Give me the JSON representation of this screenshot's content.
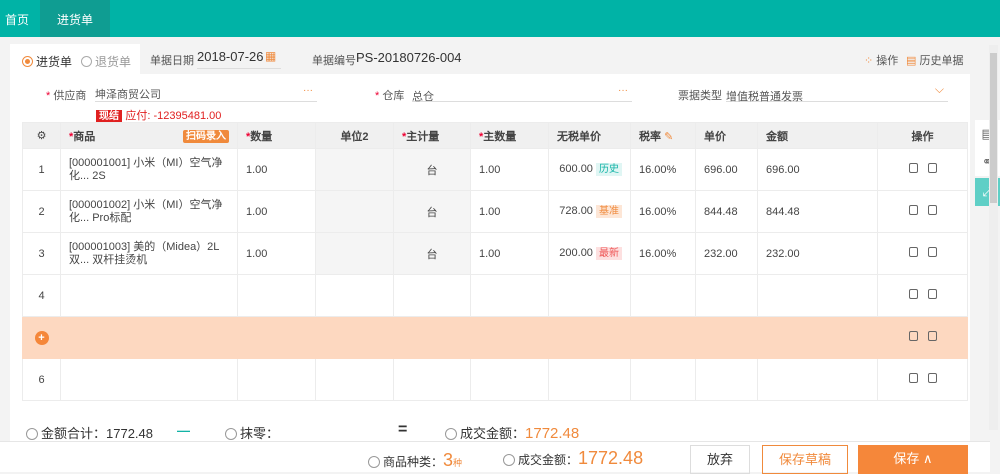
{
  "nav": {
    "home": "首页",
    "active_tab": "进货单"
  },
  "header": {
    "type_purchase": "进货单",
    "type_return": "退货单",
    "date_label": "单据日期",
    "date": "2018-07-26",
    "number_label": "单据编号",
    "number": "PS-20180726-004",
    "ops": "操作",
    "history": "历史单据"
  },
  "form": {
    "supplier_label": "供应商",
    "supplier": "坤泽商贸公司",
    "warehouse_label": "仓库",
    "warehouse": "总仓",
    "invoice_label": "票据类型",
    "invoice": "增值税普通发票",
    "cash_badge": "现结",
    "payable": "应付: -12395481.00",
    "dots": "···",
    "required": "*"
  },
  "table": {
    "scan_btn": "扫码录入",
    "headers": [
      "",
      "商品",
      "数量",
      "单位2",
      "主计量",
      "主数量",
      "无税单价",
      "税率",
      "单价",
      "金额",
      "操作"
    ],
    "rows": [
      {
        "no": "1",
        "product": "[000001001] 小米（MI）空气净化... 2S",
        "qty": "1.00",
        "unit": "台",
        "main_qty": "1.00",
        "price_ex": "600.00",
        "tag": "历史",
        "tax": "16.00%",
        "price": "696.00",
        "amount": "696.00"
      },
      {
        "no": "2",
        "product": "[000001002] 小米（MI）空气净化... Pro标配",
        "qty": "1.00",
        "unit": "台",
        "main_qty": "1.00",
        "price_ex": "728.00",
        "tag": "基准",
        "tax": "16.00%",
        "price": "844.48",
        "amount": "844.48"
      },
      {
        "no": "3",
        "product": "[000001003] 美的（Midea）2L 双... 双杆挂烫机",
        "qty": "1.00",
        "unit": "台",
        "main_qty": "1.00",
        "price_ex": "200.00",
        "tag": "最新",
        "tax": "16.00%",
        "price": "232.00",
        "amount": "232.00"
      }
    ],
    "empty_rows": [
      "4",
      "6"
    ]
  },
  "summary": {
    "total_label": "金额合计：",
    "total": "1772.48",
    "minus": "—",
    "round_label": "抹零：",
    "equals": "=",
    "deal_label": "成交金额：",
    "deal": "1772.48"
  },
  "footer": {
    "kinds_label": "商品种类：",
    "kinds": "3",
    "kinds_unit": "种",
    "deal_label": "成交金额：",
    "deal": "1772.48",
    "discard": "放弃",
    "draft": "保存草稿",
    "save": "保存 ∧"
  },
  "colors": {
    "teal": "#00b3a6",
    "orange": "#f08a3c"
  }
}
